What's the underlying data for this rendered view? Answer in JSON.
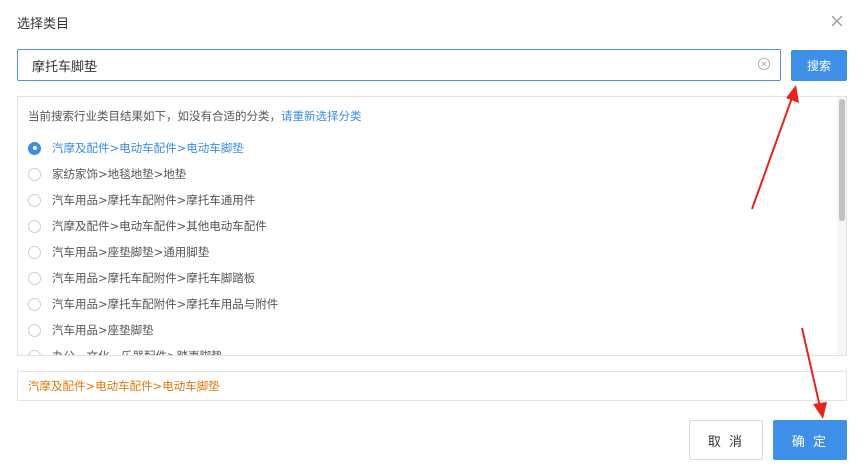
{
  "dialog": {
    "title": "选择类目",
    "close_icon": "close-icon"
  },
  "search": {
    "value": "摩托车脚垫",
    "placeholder": "",
    "clear_icon": "clear-circle-icon",
    "button_label": "搜索"
  },
  "results": {
    "hint_text": "当前搜索行业类目结果如下，如没有合适的分类，",
    "reselect_link": "请重新选择分类",
    "items": [
      {
        "label": "汽摩及配件>电动车配件>电动车脚垫",
        "checked": true
      },
      {
        "label": "家纺家饰>地毯地垫>地垫",
        "checked": false
      },
      {
        "label": "汽车用品>摩托车配附件>摩托车通用件",
        "checked": false
      },
      {
        "label": "汽摩及配件>电动车配件>其他电动车配件",
        "checked": false
      },
      {
        "label": "汽车用品>座垫脚垫>通用脚垫",
        "checked": false
      },
      {
        "label": "汽车用品>摩托车配附件>摩托车脚踏板",
        "checked": false
      },
      {
        "label": "汽车用品>摩托车配附件>摩托车用品与附件",
        "checked": false
      },
      {
        "label": "汽车用品>座垫脚垫",
        "checked": false
      },
      {
        "label": "办公、文化、乐器配件>踏夷脚垫",
        "checked": false
      }
    ]
  },
  "selected": {
    "path": "汽摩及配件>电动车配件>电动车脚垫"
  },
  "footer": {
    "cancel_label": "取 消",
    "confirm_label": "确 定"
  },
  "colors": {
    "accent": "#3d8fe8",
    "selected_path": "#e07a10",
    "annotation_arrow": "#e8231d"
  }
}
